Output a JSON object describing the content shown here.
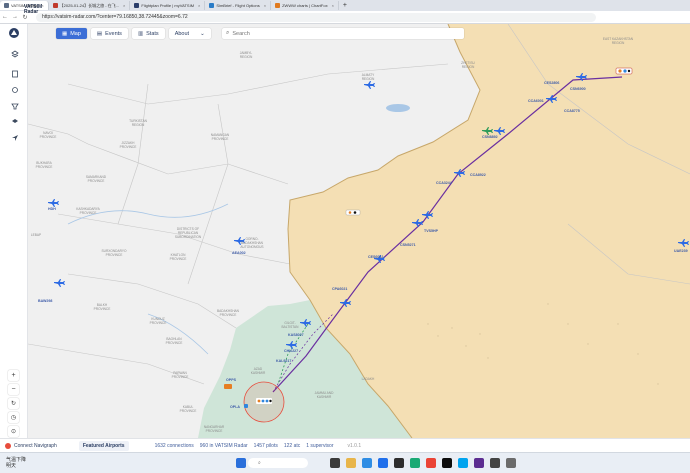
{
  "browser": {
    "tabs": [
      {
        "label": "VATSIM Radar",
        "active": true
      },
      {
        "label": "【2025-01-24】长城之旅 - 在飞..."
      },
      {
        "label": "Flightplan Profile | myVATSIM"
      },
      {
        "label": "SimBrief - Flight Options"
      },
      {
        "label": "ZWWW charts | ChartFox"
      }
    ],
    "url": "https://vatsim-radar.com/?center=79.16850,38.72445&zoom=6.72"
  },
  "app": {
    "brand_line1": "VATSIM",
    "brand_line2": "Radar"
  },
  "topnav": {
    "map": "Map",
    "events": "Events",
    "stats": "Stats",
    "about": "About"
  },
  "search": {
    "placeholder": "Search"
  },
  "map": {
    "regions": [
      "ALMATY REGION",
      "JAMBYL REGION",
      "ZHETISU REGION",
      "TURKISTAN REGION",
      "NAVOI PROVINCE",
      "SAMARKAND PROVINCE",
      "JIZZAKH PROVINCE",
      "NAMANGAN PROVINCE",
      "BUKHARA PROVINCE",
      "KASHKADARYA PROVINCE",
      "DISTRICTS OF REPUBLICAN SUBORDINATION",
      "GORNO-BADAKHSHAN AUTONOMOUS PROVINCE",
      "LEBAP",
      "KHATLON PROVINCE",
      "SURXONDARYO PROVINCE",
      "BALKH PROVINCE",
      "KUNDUZ PROVINCE",
      "BAGHLAN PROVINCE",
      "PARWAN PROVINCE",
      "KABUL PROVINCE",
      "NANGARHAR PROVINCE",
      "BADAKHSHAN PROVINCE",
      "GILGIT-BALTISTAN",
      "AZAD KASHMIR",
      "JAMMU AND KASHMIR",
      "LADAKH",
      "KARAGANDY REGION",
      "EAST KAZAKHSTAN REGION"
    ],
    "callsigns": [
      "CES2806",
      "CSN6900",
      "CCA6001",
      "CCA8775",
      "CSN8892",
      "CCA3244",
      "CCA8922",
      "TVS5HP",
      "CSN5271",
      "CES6042",
      "CPA6021",
      "CHI6227",
      "KAL9217",
      "KAS8027",
      "AEA002",
      "UAE239",
      "BAW298",
      "HDH",
      "OPPS",
      "OPLA"
    ],
    "airports": [
      "OPPS",
      "OPLA",
      "ZWSH",
      "ZWWW"
    ]
  },
  "statusbar": {
    "connect": "Connect Navigraph",
    "featured": "Featured Airports",
    "connections": "1632 connections",
    "in_radar": "960 in VATSIM Radar",
    "pilots": "1457 pilots",
    "atc": "122 atc",
    "supervisor": "1 supervisor",
    "version": "v1.0.1"
  },
  "taskbar": {
    "weather_line1": "气温下降",
    "weather_line2": "明天"
  },
  "colors": {
    "china_fill": "#f4dfb4",
    "pakistan_fill": "#cfe5d8",
    "route": "#6a2fa0",
    "aircraft": "#2d6be4",
    "accent": "#3c6ed6"
  }
}
